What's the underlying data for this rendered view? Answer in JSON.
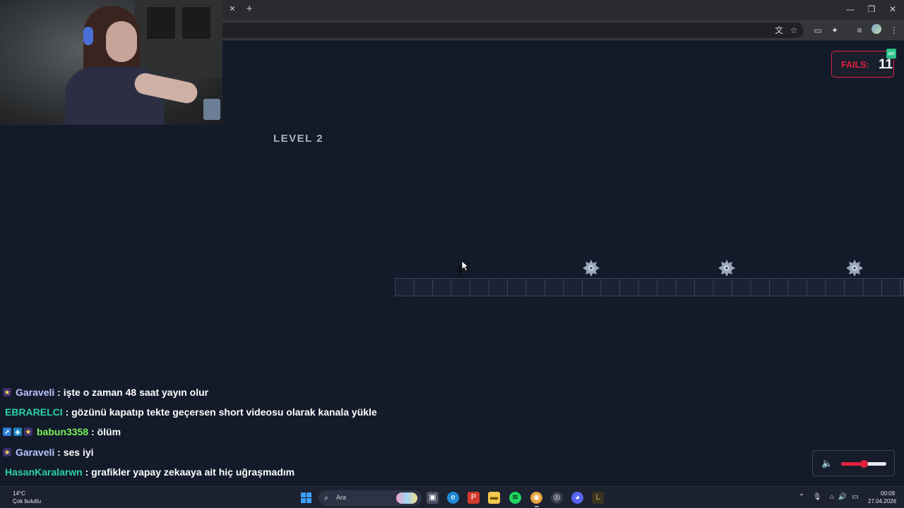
{
  "browser": {
    "tab_close_glyph": "✕",
    "new_tab_glyph": "+",
    "window_controls": {
      "minimize": "—",
      "maximize": "❐",
      "close": "✕"
    },
    "toolbar_icons": [
      "translate-icon",
      "star-icon",
      "reading-mode-icon",
      "extensions-icon",
      "media-icon",
      "profile-icon",
      "menu-icon"
    ]
  },
  "game": {
    "level_title": "LEVEL 2",
    "fails_label": "FAILS:",
    "fails_count": "11",
    "fails_badge": "ae"
  },
  "chat": {
    "messages": [
      {
        "badges": [
          "star-badge"
        ],
        "user": "Garaveli",
        "user_color": "#b9c6ff",
        "text": ": işte o zaman 48 saat yayın olur"
      },
      {
        "badges": [],
        "user": "EBRARELCI",
        "user_color": "#2bd1a7",
        "text": ": gözünü kapatıp tekte geçersen short videosu olarak kanala yükle"
      },
      {
        "badges": [
          "arrow-badge",
          "cube-badge",
          "star-badge"
        ],
        "user": "babun3358",
        "user_color": "#7cf25a",
        "text": ": ölüm"
      },
      {
        "badges": [
          "star-badge"
        ],
        "user": "Garaveli",
        "user_color": "#b9c6ff",
        "text": ": ses iyi"
      },
      {
        "badges": [],
        "user": "HasanKaralarwn",
        "user_color": "#2bd1a7",
        "text": ": grafikler yapay zekaaya ait hiç uğraşmadım"
      }
    ]
  },
  "volume": {
    "icon": "speaker-icon",
    "level": 0.5,
    "accent": "#e0213c"
  },
  "taskbar": {
    "weather_temp": "14°C",
    "weather_desc": "Çok bulutlu",
    "search_placeholder": "Ara",
    "clock_time": "00:09",
    "clock_date": "27.04.2026"
  },
  "colors": {
    "background": "#131a2a",
    "fails_accent": "#e0213c",
    "level_text": "#aab3c2"
  }
}
